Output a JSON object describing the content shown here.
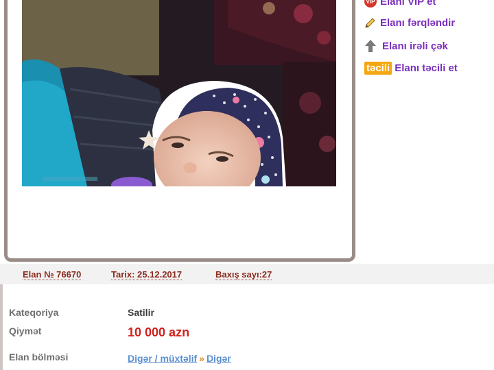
{
  "actions": {
    "vip_badge": "VIP",
    "vip_label": "Elanı VIP et",
    "highlight_label": "Elanı fərqləndir",
    "bump_label": "Elanı irəli çək",
    "urgent_badge": "təcili",
    "urgent_label": "Elanı təcili et"
  },
  "meta": {
    "ad_number": "Elan № 76670",
    "date": "Tarix: 25.12.2017",
    "views": "Baxış sayı:27"
  },
  "details": {
    "category_label": "Kateqoriya",
    "category_value": "Satilir",
    "price_label": "Qiymət",
    "price_value": "10 000 azn",
    "section_label": "Elan bölməsi",
    "section_link1": "Digər / müxtəlif",
    "section_sep": "»",
    "section_link2": "Digər"
  },
  "colors": {
    "link_purple": "#7b2fbe",
    "meta_text": "#8b2b1f",
    "price_red": "#d0211c",
    "urgent_orange": "#f5a612",
    "frame": "#9a8c87"
  }
}
